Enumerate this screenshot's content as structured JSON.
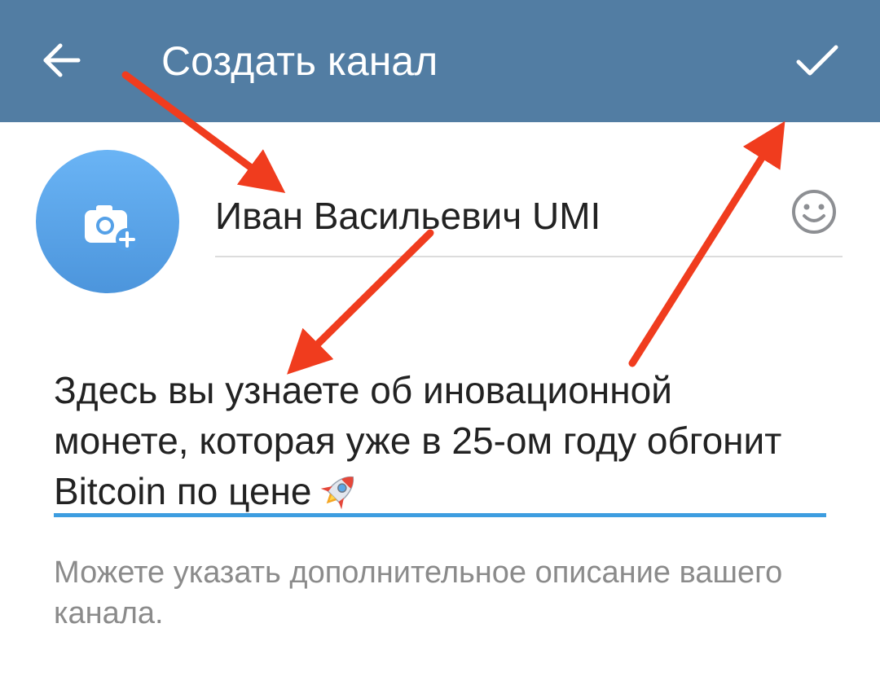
{
  "colors": {
    "app_bar": "#527da3",
    "avatar": "#5aa4eb",
    "accent_underline": "#3d9de0",
    "annotation_arrow": "#f03c1e",
    "hint_text": "#8b8b8b"
  },
  "app_bar": {
    "back_icon": "arrow-left-icon",
    "title": "Создать канал",
    "confirm_icon": "checkmark-icon"
  },
  "channel": {
    "avatar_icon": "camera-add-icon",
    "name": "Иван Васильевич UMI",
    "emoji_icon": "smiley-icon",
    "description": "Здесь вы узнаете об иновационной монете, которая уже в 25-ом году обгонит Bitcoin по цене",
    "description_emoji": "rocket-emoji",
    "hint": "Можете указать дополнительное описание вашего канала."
  },
  "annotations": {
    "arrow_count": 3,
    "targets": [
      "channel-name",
      "channel-description",
      "confirm"
    ]
  }
}
